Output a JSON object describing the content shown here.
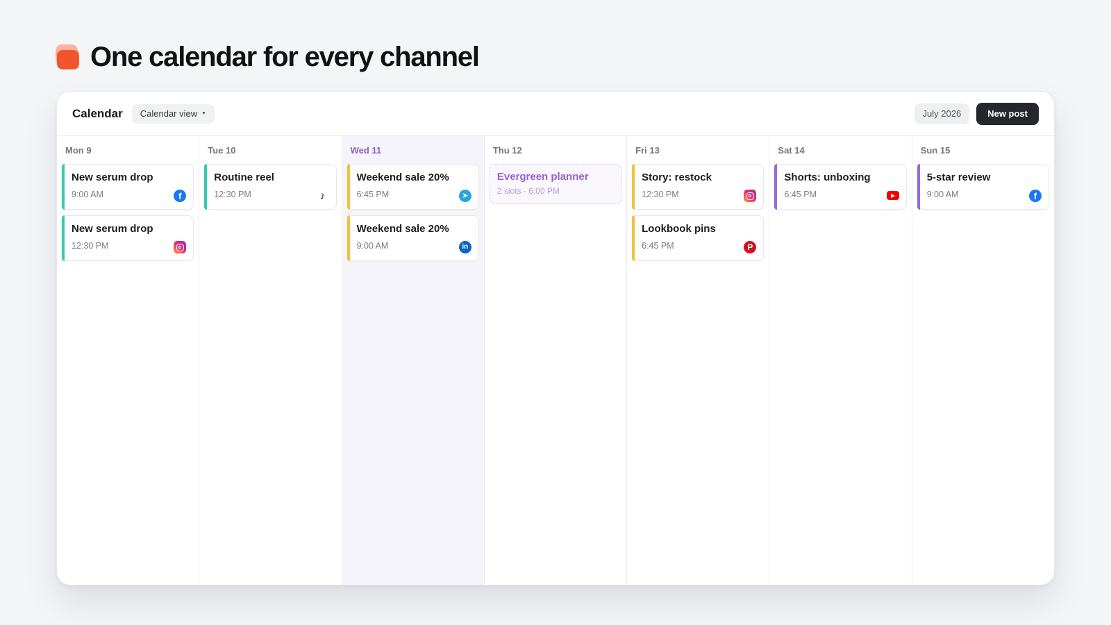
{
  "hero": {
    "title": "One calendar for every channel",
    "logo_icon": "layered-card-logo",
    "logo_color": "#f2552c"
  },
  "toolbar": {
    "title": "Calendar",
    "view_label": "Calendar view",
    "month_label": "July 2026",
    "new_post_label": "New post"
  },
  "colors": {
    "today": "#8d5ec6",
    "teal": "#3ac8b0",
    "amber": "#f0c13c",
    "purple": "#9a6ad6"
  },
  "days": [
    {
      "label": "Mon 9",
      "items": [
        {
          "title": "New serum drop",
          "time": "9:00 AM",
          "network": "facebook",
          "accent": "#3ac8b0"
        },
        {
          "title": "New serum drop",
          "time": "12:30 PM",
          "network": "instagram",
          "accent": "#3ac8b0"
        }
      ]
    },
    {
      "label": "Tue 10",
      "items": [
        {
          "title": "Routine reel",
          "time": "12:30 PM",
          "network": "tiktok",
          "accent": "#3ac8b0"
        }
      ]
    },
    {
      "label": "Wed 11",
      "today": true,
      "items": [
        {
          "title": "Weekend sale 20%",
          "time": "6:45 PM",
          "network": "telegram",
          "accent": "#f0c13c"
        },
        {
          "title": "Weekend sale 20%",
          "time": "9:00 AM",
          "network": "linkedin",
          "accent": "#f0c13c"
        }
      ]
    },
    {
      "label": "Thu 12",
      "items": [
        {
          "type": "slot",
          "title": "Evergreen planner",
          "subtitle": "2 slots · 6:00 PM"
        }
      ]
    },
    {
      "label": "Fri 13",
      "items": [
        {
          "title": "Story: restock",
          "time": "12:30 PM",
          "network": "instagram",
          "accent": "#f0c13c"
        },
        {
          "title": "Lookbook pins",
          "time": "6:45 PM",
          "network": "pinterest",
          "accent": "#f0c13c"
        }
      ]
    },
    {
      "label": "Sat 14",
      "items": [
        {
          "title": "Shorts: unboxing",
          "time": "6:45 PM",
          "network": "youtube",
          "accent": "#9a6ad6"
        }
      ]
    },
    {
      "label": "Sun 15",
      "items": [
        {
          "title": "5-star review",
          "time": "9:00 AM",
          "network": "facebook",
          "accent": "#9a6ad6"
        }
      ]
    }
  ]
}
